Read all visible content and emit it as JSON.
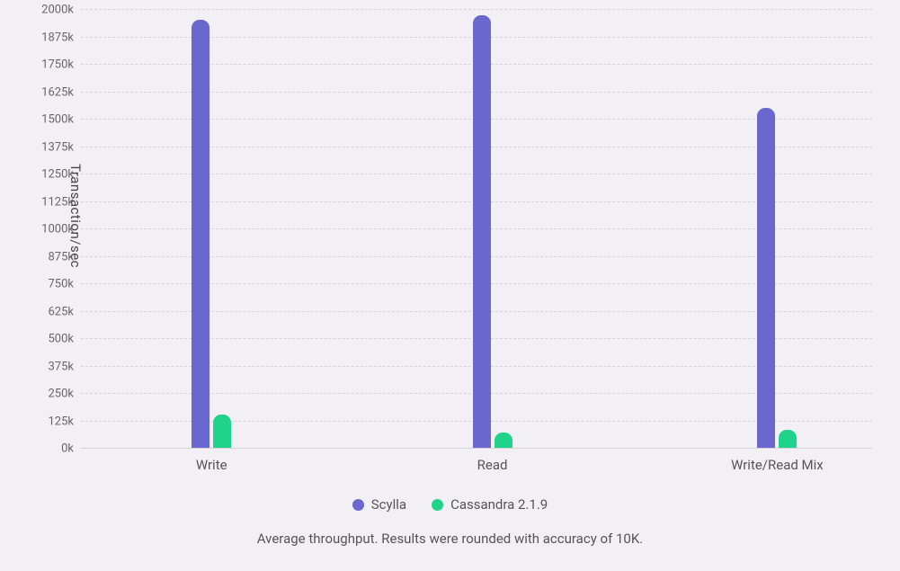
{
  "chart_data": {
    "type": "bar",
    "ylabel": "Transaction/sec",
    "xlabel": "",
    "categories": [
      "Write",
      "Read",
      "Write/Read Mix"
    ],
    "series": [
      {
        "name": "Scylla",
        "values": [
          1950000,
          1970000,
          1550000
        ],
        "color": "#6a67ce"
      },
      {
        "name": "Cassandra 2.1.9",
        "values": [
          150000,
          70000,
          80000
        ],
        "color": "#1fd38b"
      }
    ],
    "ylim": [
      0,
      2000000
    ],
    "yticks": [
      0,
      125000,
      250000,
      375000,
      500000,
      625000,
      750000,
      875000,
      1000000,
      1125000,
      1250000,
      1375000,
      1500000,
      1625000,
      1750000,
      1875000,
      2000000
    ],
    "ytick_labels": [
      "0k",
      "125k",
      "250k",
      "375k",
      "500k",
      "625k",
      "750k",
      "875k",
      "1000k",
      "1125k",
      "1250k",
      "1375k",
      "1500k",
      "1625k",
      "1750k",
      "1875k",
      "2000k"
    ],
    "caption": "Average throughput. Results were rounded with accuracy of 10K."
  },
  "legend": {
    "s0": "Scylla",
    "s1": "Cassandra 2.1.9"
  },
  "axis": {
    "ylabel": "Transaction/sec",
    "cat0": "Write",
    "cat1": "Read",
    "cat2": "Write/Read Mix"
  },
  "ticks": {
    "t0": "0k",
    "t1": "125k",
    "t2": "250k",
    "t3": "375k",
    "t4": "500k",
    "t5": "625k",
    "t6": "750k",
    "t7": "875k",
    "t8": "1000k",
    "t9": "1125k",
    "t10": "1250k",
    "t11": "1375k",
    "t12": "1500k",
    "t13": "1625k",
    "t14": "1750k",
    "t15": "1875k",
    "t16": "2000k"
  },
  "caption": "Average throughput. Results were rounded with accuracy of 10K."
}
